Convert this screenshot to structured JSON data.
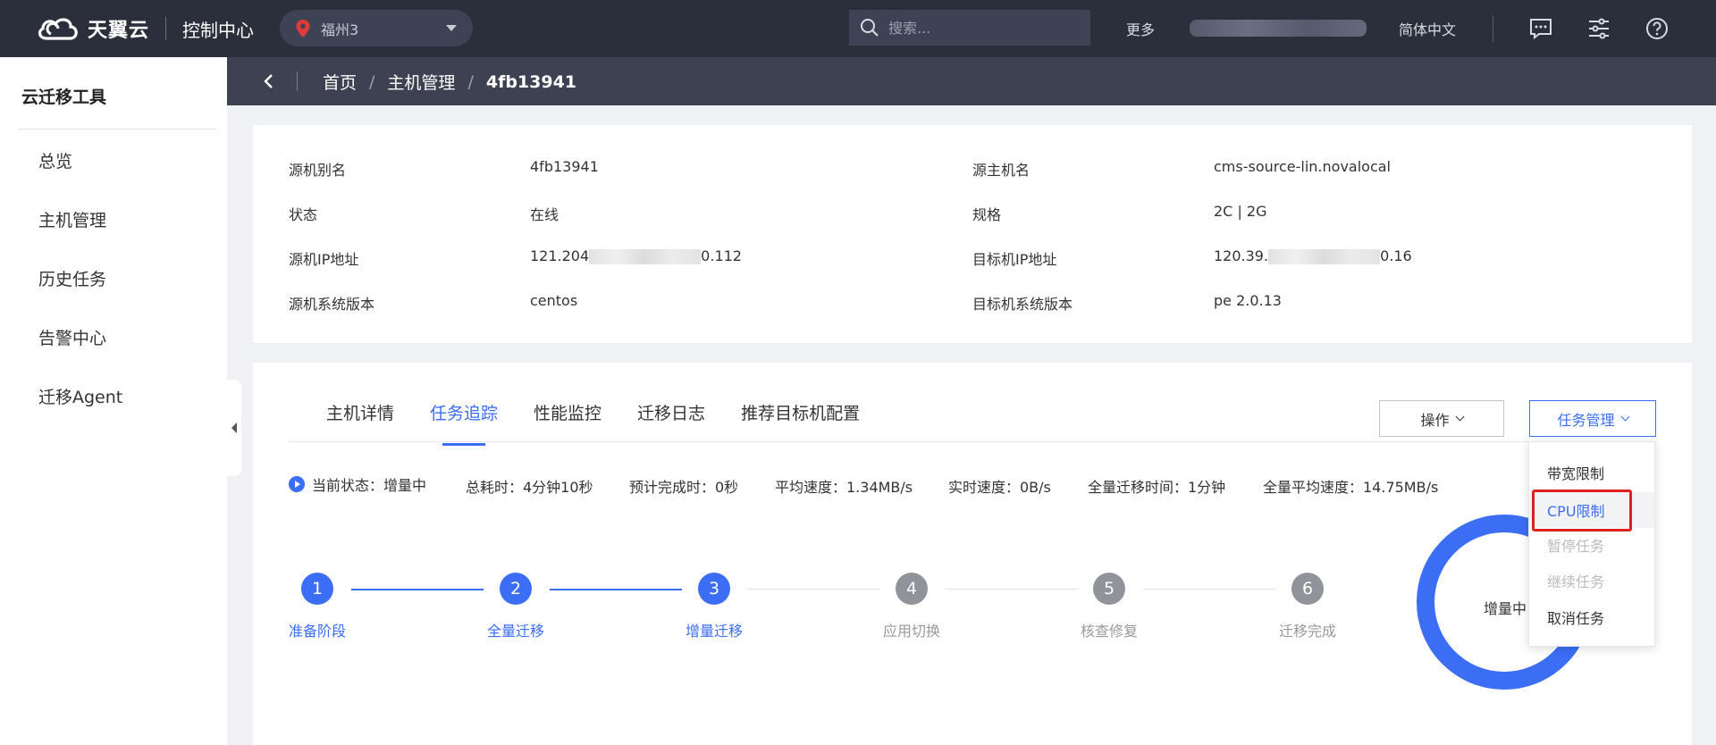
{
  "topbar": {
    "brand": "天翼云",
    "console": "控制中心",
    "region": "福州3",
    "search_placeholder": "搜索...",
    "more": "更多",
    "language": "简体中文",
    "colors": {
      "bar": "#2b2f3b",
      "region_pin": "#e03a3a"
    }
  },
  "sidebar": {
    "title": "云迁移工具",
    "items": [
      "总览",
      "主机管理",
      "历史任务",
      "告警中心",
      "迁移Agent"
    ]
  },
  "breadcrumb": [
    "首页",
    "主机管理",
    "4fb13941"
  ],
  "info": {
    "left": [
      {
        "label": "源机别名",
        "value": "4fb13941"
      },
      {
        "label": "状态",
        "value": "在线"
      },
      {
        "label": "源机IP地址",
        "value_prefix": "121.204",
        "value_suffix": "0.112"
      },
      {
        "label": "源机系统版本",
        "value": "centos"
      }
    ],
    "right": [
      {
        "label": "源主机名",
        "value": "cms-source-lin.novalocal"
      },
      {
        "label": "规格",
        "value": "2C | 2G"
      },
      {
        "label": "目标机IP地址",
        "value_prefix": "120.39.",
        "value_suffix": "0.16"
      },
      {
        "label": "目标机系统版本",
        "value": "pe 2.0.13"
      }
    ]
  },
  "tabs": {
    "items": [
      "主机详情",
      "任务追踪",
      "性能监控",
      "迁移日志",
      "推荐目标机配置"
    ],
    "active_index": 1
  },
  "buttons": {
    "operation": "操作",
    "task_management": "任务管理"
  },
  "status": {
    "current": "当前状态：增量中",
    "total_time": "总耗时：4分钟10秒",
    "eta": "预计完成时：0秒",
    "avg_speed": "平均速度：1.34MB/s",
    "realtime_speed": "实时速度：0B/s",
    "full_time": "全量迁移时间：1分钟",
    "full_avg_speed": "全量平均速度：14.75MB/s"
  },
  "steps": [
    {
      "num": "1",
      "label": "准备阶段",
      "state": "done"
    },
    {
      "num": "2",
      "label": "全量迁移",
      "state": "done"
    },
    {
      "num": "3",
      "label": "增量迁移",
      "state": "done"
    },
    {
      "num": "4",
      "label": "应用切换",
      "state": "todo"
    },
    {
      "num": "5",
      "label": "核查修复",
      "state": "todo"
    },
    {
      "num": "6",
      "label": "迁移完成",
      "state": "todo"
    }
  ],
  "ring": {
    "label": "增量中",
    "color": "#3b6ef5"
  },
  "task_menu": [
    {
      "label": "带宽限制",
      "state": "normal"
    },
    {
      "label": "CPU限制",
      "state": "highlight"
    },
    {
      "label": "暂停任务",
      "state": "disabled"
    },
    {
      "label": "继续任务",
      "state": "disabled"
    },
    {
      "label": "取消任务",
      "state": "normal"
    }
  ],
  "accent_color": "#3b6ef5"
}
